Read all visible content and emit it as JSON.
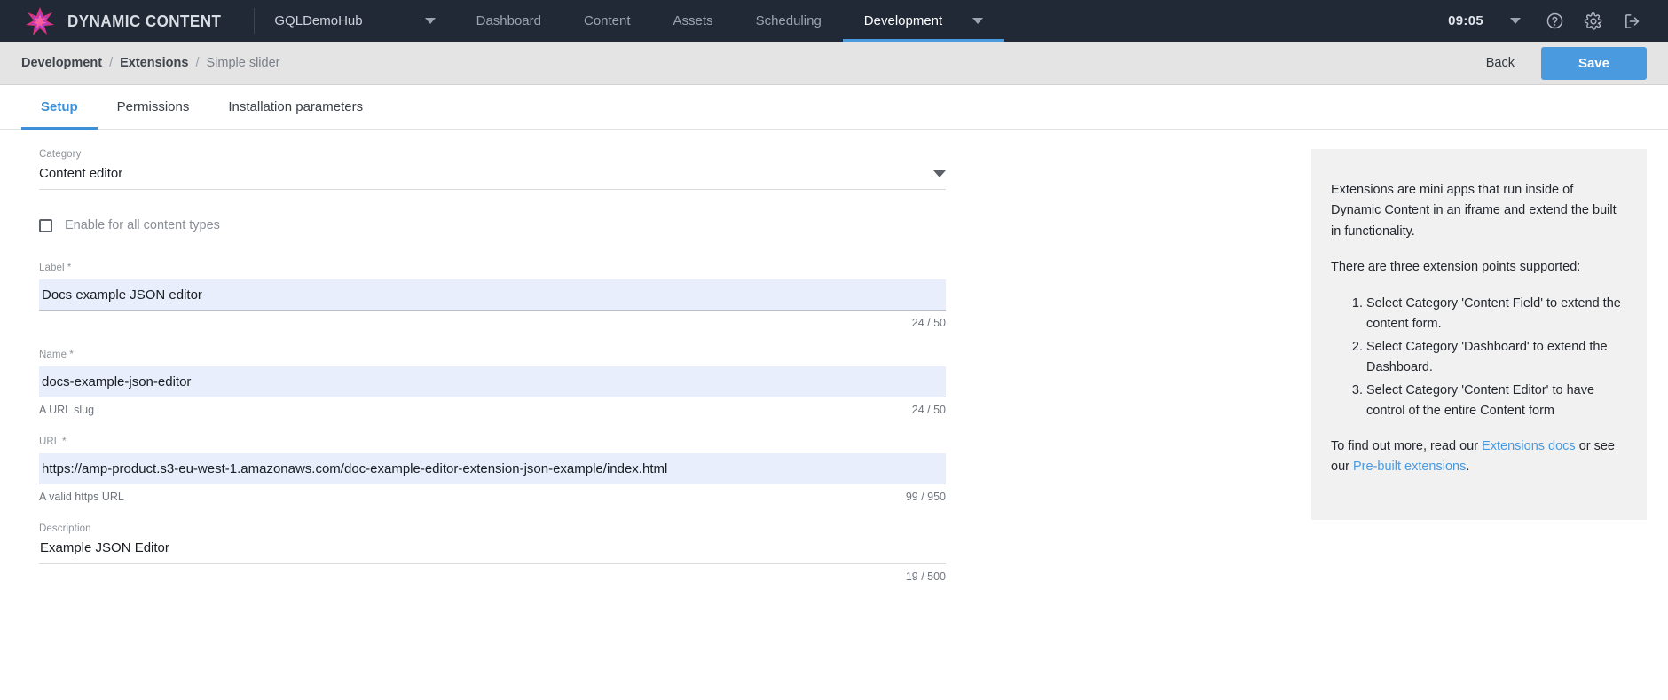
{
  "topnav": {
    "brand": "DYNAMIC CONTENT",
    "brand_logo_icon": "starburst-logo-icon",
    "tenant": "GQLDemoHub",
    "tenant_caret_icon": "chevron-down-icon",
    "items": [
      {
        "label": "Dashboard",
        "active": false
      },
      {
        "label": "Content",
        "active": false
      },
      {
        "label": "Assets",
        "active": false
      },
      {
        "label": "Scheduling",
        "active": false
      },
      {
        "label": "Development",
        "active": true
      }
    ],
    "development_caret_icon": "chevron-down-icon",
    "clock": "09:05",
    "clock_caret_icon": "chevron-down-icon",
    "help_icon": "question-circle-icon",
    "settings_icon": "gear-icon",
    "logout_icon": "logout-icon"
  },
  "breadcrumb": {
    "items": [
      "Development",
      "Extensions",
      "Simple slider"
    ],
    "separator": "/",
    "back_label": "Back",
    "save_label": "Save"
  },
  "tabs": [
    {
      "label": "Setup",
      "active": true
    },
    {
      "label": "Permissions",
      "active": false
    },
    {
      "label": "Installation parameters",
      "active": false
    }
  ],
  "form": {
    "category": {
      "label": "Category",
      "value": "Content editor",
      "caret_icon": "dropdown-caret-icon"
    },
    "enable_all_content_types": {
      "label": "Enable for all content types",
      "checked": false
    },
    "label_field": {
      "label": "Label *",
      "value": "Docs example JSON editor",
      "placeholder": "",
      "helper": "",
      "counter": "24 / 50"
    },
    "name_field": {
      "label": "Name *",
      "value": "docs-example-json-editor",
      "placeholder": "",
      "helper": "A URL slug",
      "counter": "24 / 50"
    },
    "url_field": {
      "label": "URL *",
      "value": "https://amp-product.s3-eu-west-1.amazonaws.com/doc-example-editor-extension-json-example/index.html",
      "placeholder": "",
      "helper": "A valid https URL",
      "counter": "99 / 950"
    },
    "description_field": {
      "label": "Description",
      "value": "Example JSON Editor",
      "placeholder": "",
      "helper": "",
      "counter": "19 / 500"
    }
  },
  "info_panel": {
    "paragraph1": "Extensions are mini apps that run inside of Dynamic Content in an iframe and extend the built in functionality.",
    "paragraph2": "There are three extension points supported:",
    "list": [
      "Select Category 'Content Field' to extend the content form.",
      "Select Category 'Dashboard' to extend the Dashboard.",
      "Select Category 'Content Editor' to have control of the entire Content form"
    ],
    "footer_prefix": "To find out more, read our ",
    "link1": "Extensions docs",
    "footer_middle": " or see our ",
    "link2": "Pre-built extensions",
    "footer_suffix": "."
  },
  "colors": {
    "nav_bg": "#212936",
    "accent": "#4a9ae0",
    "input_bg": "#e8eefb",
    "crumb_bg": "#e4e4e4",
    "info_bg": "#f1f1f1"
  }
}
